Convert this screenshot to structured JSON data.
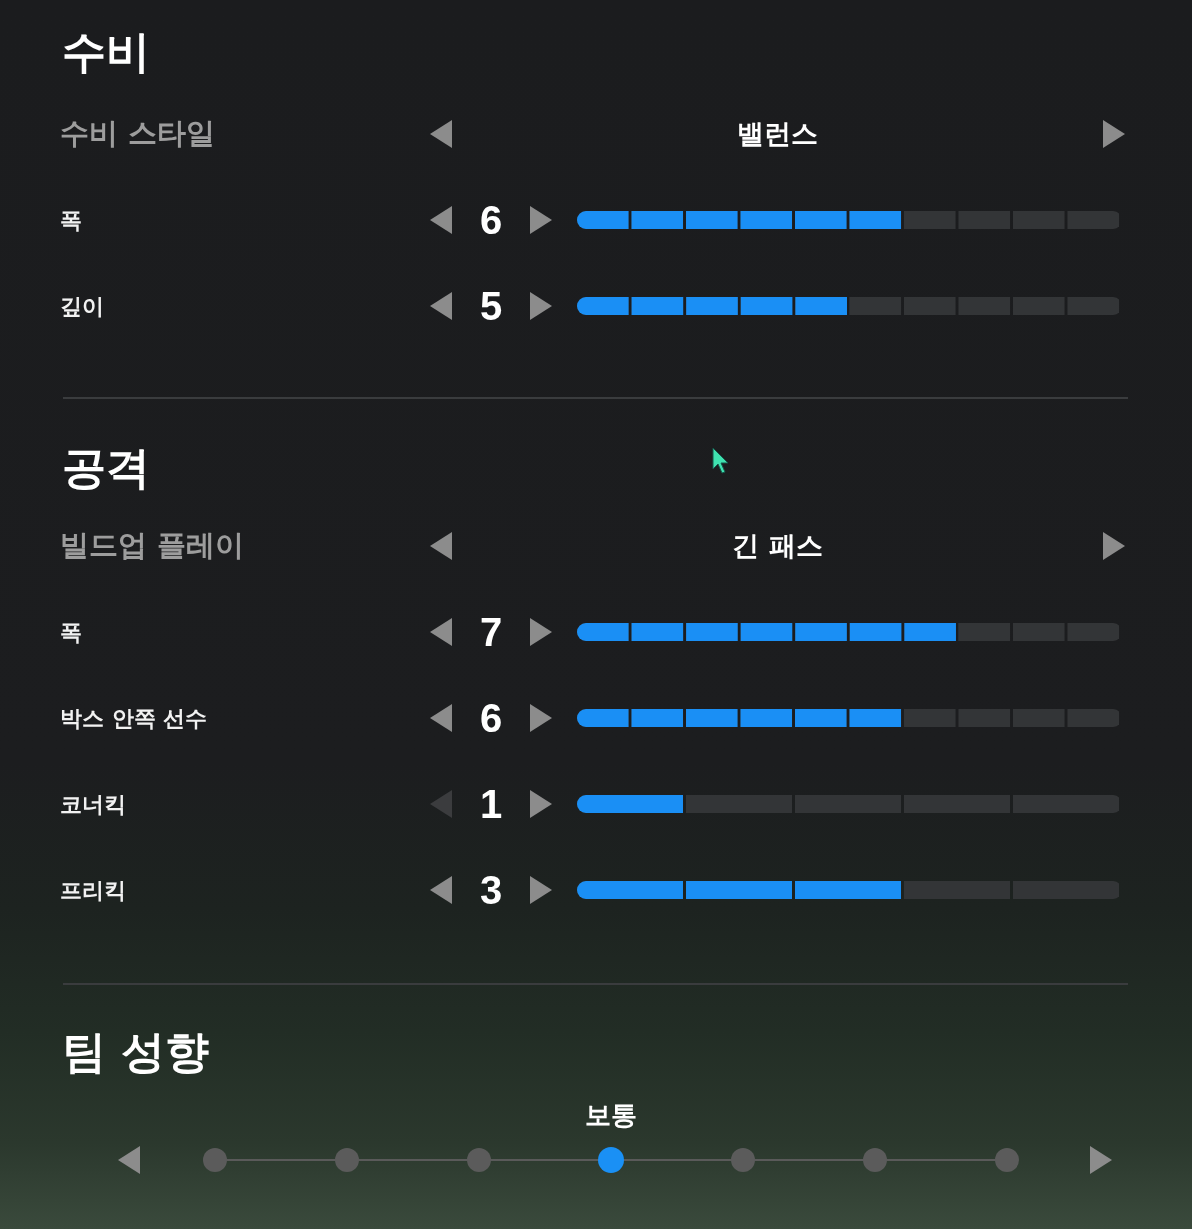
{
  "sections": [
    {
      "title": "수비",
      "rows": [
        {
          "kind": "selector",
          "label": "수비 스타일",
          "value": "밸런스",
          "prev_disabled": false
        },
        {
          "kind": "tenstep",
          "label": "폭",
          "value": "6",
          "level": 0.6,
          "prev_disabled": false
        },
        {
          "kind": "tenstep",
          "label": "깊이",
          "value": "5",
          "level": 0.5,
          "prev_disabled": false
        }
      ]
    },
    {
      "title": "공격",
      "rows": [
        {
          "kind": "selector",
          "label": "빌드업 플레이",
          "value": "긴 패스",
          "prev_disabled": false
        },
        {
          "kind": "tenstep",
          "label": "폭",
          "value": "7",
          "level": 0.7,
          "prev_disabled": false
        },
        {
          "kind": "tenstep",
          "label": "박스 안쪽 선수",
          "value": "6",
          "level": 0.6,
          "prev_disabled": false
        },
        {
          "kind": "fivestep",
          "label": "코너킥",
          "value": "1",
          "level": 0.2,
          "prev_disabled": true
        },
        {
          "kind": "fivestep",
          "label": "프리킥",
          "value": "3",
          "level": 0.6,
          "prev_disabled": false
        }
      ]
    }
  ],
  "team_style": {
    "title": "팀 성향",
    "value": "보통",
    "points": [
      {
        "selected": false
      },
      {
        "selected": false
      },
      {
        "selected": false
      },
      {
        "selected": true
      },
      {
        "selected": false
      },
      {
        "selected": false
      },
      {
        "selected": false
      }
    ]
  }
}
